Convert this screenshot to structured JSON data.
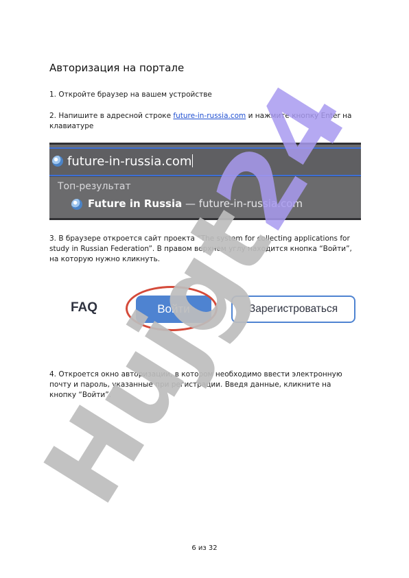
{
  "heading": "Авторизация на портале",
  "steps": {
    "step1": "1. Откройте браузер на вашем устройстве",
    "step2_before": "2. Напишите в адресной строке ",
    "step2_link": "future-in-russia.com",
    "step2_after": " и нажмите кнопку Enter на клавиатуре",
    "step3": "3. В браузере откроется сайт проекта “The system for collecting applications for study in Russian Federation”. В правом верхнем углу находится кнопка “Войти”, на которую нужно кликнуть.",
    "step4": "4. Откроется окно авторизации, в котором необходимо ввести электронную почту и пароль, указанные при регистрации. Введя данные, кликните на кнопку “Войти”."
  },
  "browser": {
    "address_value": "future-in-russia.com",
    "top_result_label": "Топ-результат",
    "result_title": "Future in Russia",
    "result_dash": " — ",
    "result_url": "future-in-russia.com"
  },
  "site_header": {
    "faq": "FAQ",
    "login": "Войти",
    "register": "Зарегистроваться"
  },
  "watermark": "Hujgt24",
  "page_number": "6 из 32",
  "colors": {
    "link": "#1f4fd1",
    "login_button": "#4e83d1",
    "highlight_ring": "#d44a3a",
    "watermark_purple": "#a89af0",
    "watermark_gray": "#bdbdbd"
  }
}
